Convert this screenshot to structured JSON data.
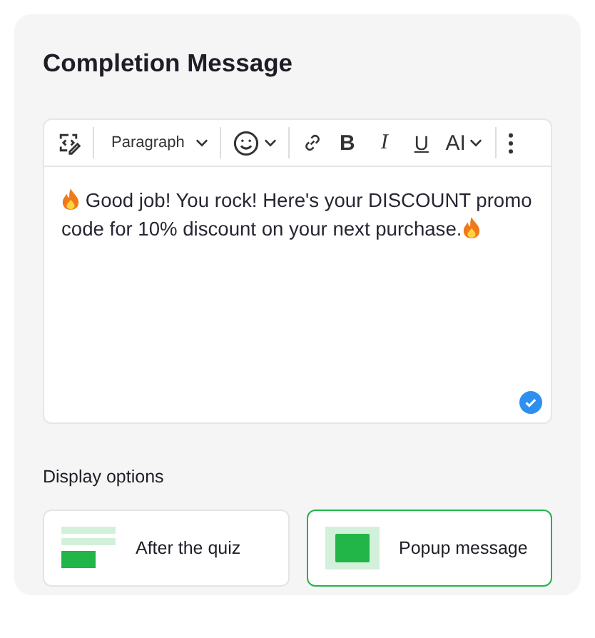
{
  "title": "Completion Message",
  "toolbar": {
    "block_style": "Paragraph",
    "marks": [
      {
        "label": "B",
        "kind": "bold"
      },
      {
        "label": "I",
        "kind": "italic"
      },
      {
        "label": "U",
        "kind": "underline"
      },
      {
        "label": "AI",
        "kind": "size"
      }
    ]
  },
  "message": {
    "text": "Good job! You rock! Here's your DISCOUNT promo code for 10% discount on your next purchase.",
    "saved": true
  },
  "display_options": {
    "label": "Display options",
    "options": [
      {
        "label": "After the quiz",
        "kind": "inline",
        "selected": false
      },
      {
        "label": "Popup message",
        "kind": "popup",
        "selected": true
      }
    ]
  }
}
